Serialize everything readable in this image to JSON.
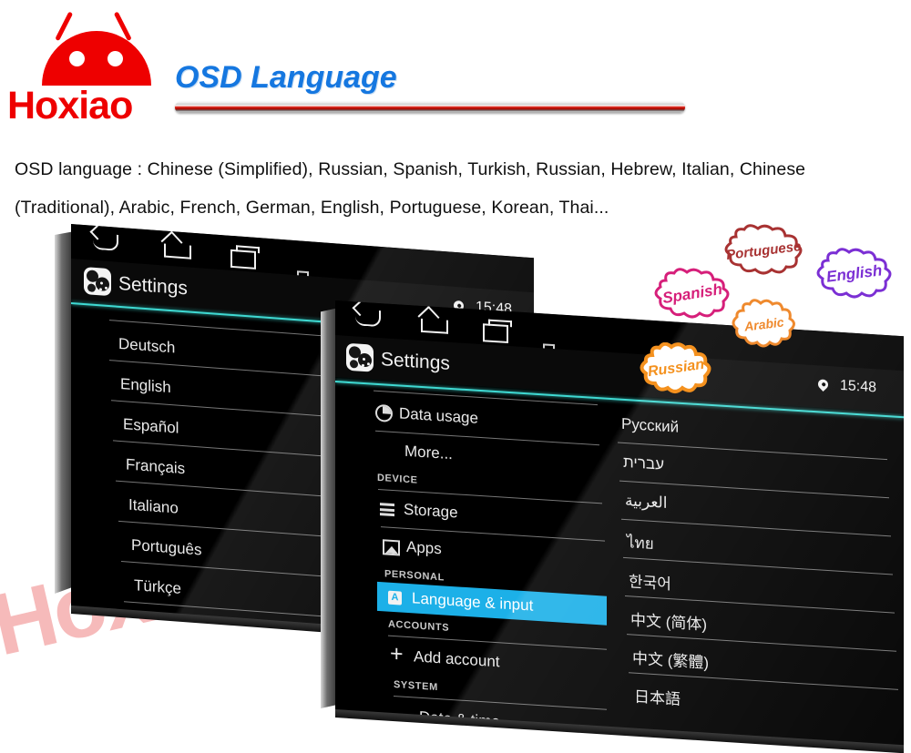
{
  "brand": {
    "name": "Hoxiao",
    "logo_color": "#ee0000",
    "watermark": "Hoxiao"
  },
  "header": {
    "title": "OSD Language",
    "title_color": "#1577e0",
    "description": "OSD language : Chinese (Simplified), Russian, Spanish, Turkish, Russian, Hebrew, Italian, Chinese (Traditional), Arabic, French, German, English, Portuguese, Korean, Thai..."
  },
  "accent_colors": {
    "teal_line": "#3fd9d2",
    "highlight_row": "#1cb0e8",
    "screen_bg": "#000000"
  },
  "tablet_back": {
    "navbar": [
      {
        "name": "back-icon",
        "label": "Back"
      },
      {
        "name": "home-icon",
        "label": "Home"
      },
      {
        "name": "recents-icon",
        "label": "Recent apps"
      },
      {
        "name": "screenshot-icon",
        "label": "Screenshot"
      }
    ],
    "app_title": "Settings",
    "app_icon": "settings-gear-icon",
    "status": {
      "location_icon": "location-pin-icon",
      "time": "15:48"
    },
    "language_list": [
      "Deutsch",
      "English",
      "Español",
      "Français",
      "Italiano",
      "Português",
      "Türkçe"
    ]
  },
  "tablet_front": {
    "navbar": [
      {
        "name": "back-icon",
        "label": "Back"
      },
      {
        "name": "home-icon",
        "label": "Home"
      },
      {
        "name": "recents-icon",
        "label": "Recent apps"
      },
      {
        "name": "screenshot-icon",
        "label": "Screenshot"
      }
    ],
    "app_title": "Settings",
    "app_icon": "settings-gear-icon",
    "status": {
      "location_icon": "location-pin-icon",
      "time": "15:48"
    },
    "settings_menu": [
      {
        "type": "item",
        "label": "Data usage",
        "icon": "data-usage-icon",
        "selected": false
      },
      {
        "type": "item",
        "label": "More...",
        "icon": "",
        "selected": false
      },
      {
        "type": "section",
        "label": "DEVICE"
      },
      {
        "type": "item",
        "label": "Storage",
        "icon": "storage-icon",
        "selected": false
      },
      {
        "type": "item",
        "label": "Apps",
        "icon": "apps-icon",
        "selected": false
      },
      {
        "type": "section",
        "label": "PERSONAL"
      },
      {
        "type": "item",
        "label": "Language & input",
        "icon": "language-badge-icon",
        "badge": "A",
        "selected": true
      },
      {
        "type": "section",
        "label": "ACCOUNTS"
      },
      {
        "type": "item",
        "label": "Add account",
        "icon": "plus-icon",
        "selected": false
      },
      {
        "type": "section",
        "label": "SYSTEM"
      },
      {
        "type": "item",
        "label": "Date & time",
        "icon": "clock-icon",
        "selected": false
      }
    ],
    "language_list": [
      "Русский",
      "עברית",
      "العربية",
      "ไทย",
      "한국어",
      "中文 (简体)",
      "中文 (繁體)",
      "日本語"
    ]
  },
  "bubbles": [
    {
      "label": "Portuguese",
      "color": "#a83232"
    },
    {
      "label": "English",
      "color": "#7b2fd4"
    },
    {
      "label": "Spanish",
      "color": "#d61f7a"
    },
    {
      "label": "Arabic",
      "color": "#ef8a2e"
    },
    {
      "label": "Russian",
      "color": "#f4911e"
    }
  ]
}
